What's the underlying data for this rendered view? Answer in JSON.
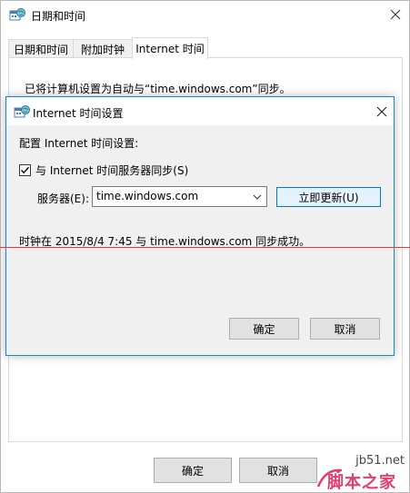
{
  "parent_window": {
    "title": "日期和时间",
    "tabs": [
      {
        "label": "日期和时间",
        "active": false
      },
      {
        "label": "附加时钟",
        "active": false
      },
      {
        "label": "Internet 时间",
        "active": true
      }
    ],
    "sync_status_text": "已将计算机设置为自动与“time.windows.com”同步。",
    "ok_label": "确定",
    "cancel_label": "取消"
  },
  "dialog": {
    "title": "Internet 时间设置",
    "config_label": "配置 Internet 时间设置:",
    "sync_checkbox": {
      "label": "与 Internet 时间服务器同步(S)",
      "checked": true
    },
    "server_label": "服务器(E):",
    "server_value": "time.windows.com",
    "update_now_label": "立即更新(U)",
    "success_message": "时钟在 2015/8/4 7:45 与 time.windows.com 同步成功。",
    "ok_label": "确定",
    "cancel_label": "取消"
  },
  "watermark": {
    "url": "jb51.net",
    "name": "脚本之家"
  },
  "colors": {
    "accent_border": "#1883d7",
    "focus_button_border": "#0078d7",
    "red_guide_line": "#e03a3a",
    "watermark_name": "#e23f6a"
  },
  "icons": {
    "window_icon": "date-time-globe-icon",
    "close": "close-icon",
    "check": "checkmark-icon",
    "dropdown": "chevron-down-icon"
  }
}
